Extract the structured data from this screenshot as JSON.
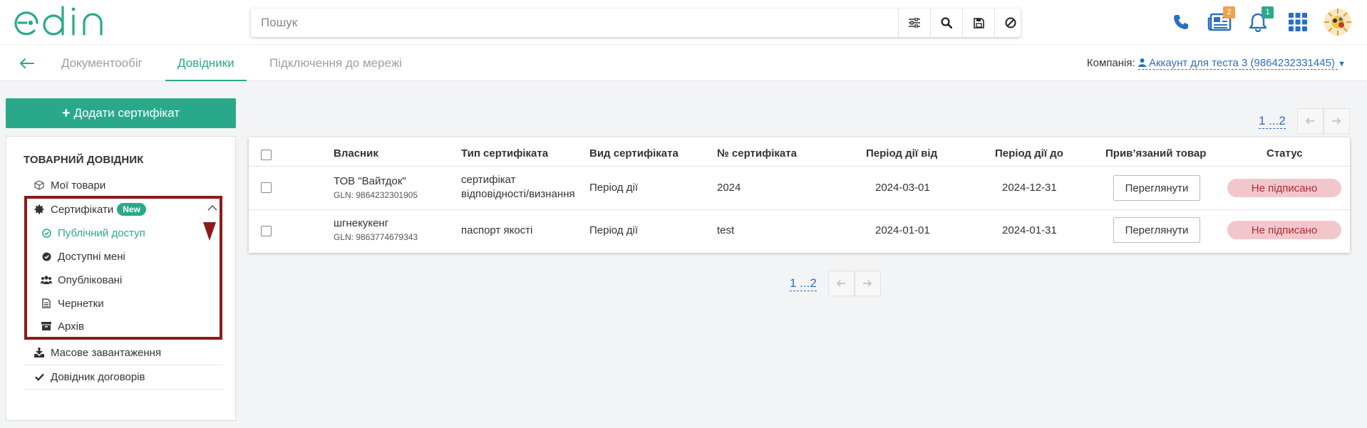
{
  "header": {
    "search_placeholder": "Пошук",
    "icons": [
      "filter-icon",
      "search-icon",
      "save-icon",
      "cancel-icon"
    ],
    "news_badge": "2",
    "notifications_badge": "1"
  },
  "nav": {
    "tabs": [
      {
        "label": "Документообіг"
      },
      {
        "label": "Довідники"
      },
      {
        "label": "Підключення до мережі"
      }
    ],
    "active_tab": "Довідники",
    "company_label": "Компанія:",
    "company_value": "Аккаунт для теста 3 (9864232331445)"
  },
  "sidebar": {
    "add_button": "Додати сертифікат",
    "title": "ТОВАРНИЙ ДОВІДНИК",
    "my_goods": "Мої товари",
    "certificates": "Сертифікати",
    "new_badge": "New",
    "sub": [
      "Публічний доступ",
      "Доступні мені",
      "Опубліковані",
      "Чернетки",
      "Архів"
    ],
    "mass_upload": "Масове завантаження",
    "contracts": "Довідник договорів"
  },
  "pagination": {
    "pages": "1 ...2"
  },
  "table": {
    "headers": [
      "Власник",
      "Тип сертифіката",
      "Вид сертифіката",
      "№ сертифіката",
      "Період дії від",
      "Період дії до",
      "Прив’язаний товар",
      "Статус"
    ],
    "rows": [
      {
        "owner": "ТОВ \"Вайтдок\"",
        "gln": "GLN: 9864232301905",
        "type_line1": "сертифікат",
        "type_line2": "відповідності/визнання",
        "kind": "Період дії",
        "number": "2024",
        "from": "2024-03-01",
        "to": "2024-12-31",
        "view": "Переглянути",
        "status": "Не підписано"
      },
      {
        "owner": "шгнекукенг",
        "gln": "GLN: 9863774679343",
        "type_line1": "паспорт якості",
        "type_line2": "",
        "kind": "Період дії",
        "number": "test",
        "from": "2024-01-01",
        "to": "2024-01-31",
        "view": "Переглянути",
        "status": "Не підписано"
      }
    ]
  },
  "colors": {
    "accent": "#2aa98a",
    "link": "#2a6fc4",
    "status_bg": "#f2c7cc",
    "highlight": "#8b1a1a"
  }
}
